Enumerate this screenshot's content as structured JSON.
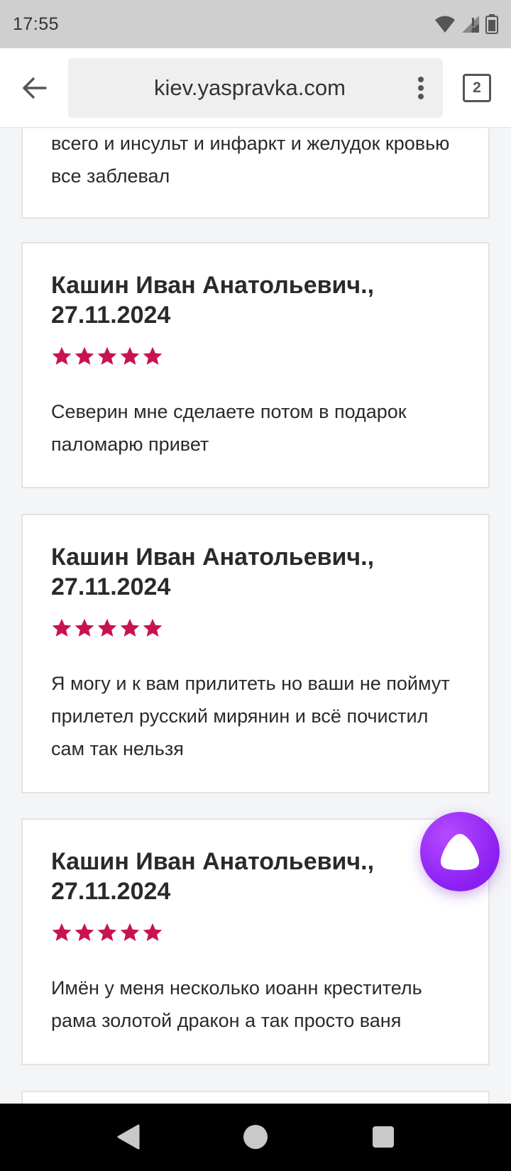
{
  "status_bar": {
    "time": "17:55",
    "icons": [
      "wifi-icon",
      "signal-icon",
      "battery-icon"
    ]
  },
  "browser": {
    "url": "kiev.yaspravka.com",
    "tab_count": "2",
    "icons": [
      "back-arrow-icon",
      "more-vert-icon",
      "tabs-icon"
    ]
  },
  "reviews": {
    "partial": {
      "text": "всего и инсульт и инфаркт и желудок кровью все заблевал"
    },
    "items": [
      {
        "name": "Кашин Иван Анатольевич., 27.11.2024",
        "rating": 5,
        "text": "Северин мне сделаете потом в подарок паломарю привет"
      },
      {
        "name": "Кашин Иван Анатольевич., 27.11.2024",
        "rating": 5,
        "text": "Я могу и к вам прилитеть но ваши не поймут прилетел русский мирянин и всё почистил сам так нельзя"
      },
      {
        "name": "Кашин Иван Анатольевич., 27.11.2024",
        "rating": 5,
        "text": "Имён у меня несколько иоанн креститель рама золотой дракон а так просто ваня"
      }
    ]
  },
  "colors": {
    "star": "#c8144e",
    "alice_button": "#8a1ff2",
    "status_bar_bg": "#cfcfcf",
    "nav_bar_bg": "#000000"
  },
  "floating": {
    "icon": "alice-assistant-icon"
  },
  "nav": {
    "icons": [
      "nav-back-icon",
      "nav-home-icon",
      "nav-recents-icon"
    ]
  }
}
